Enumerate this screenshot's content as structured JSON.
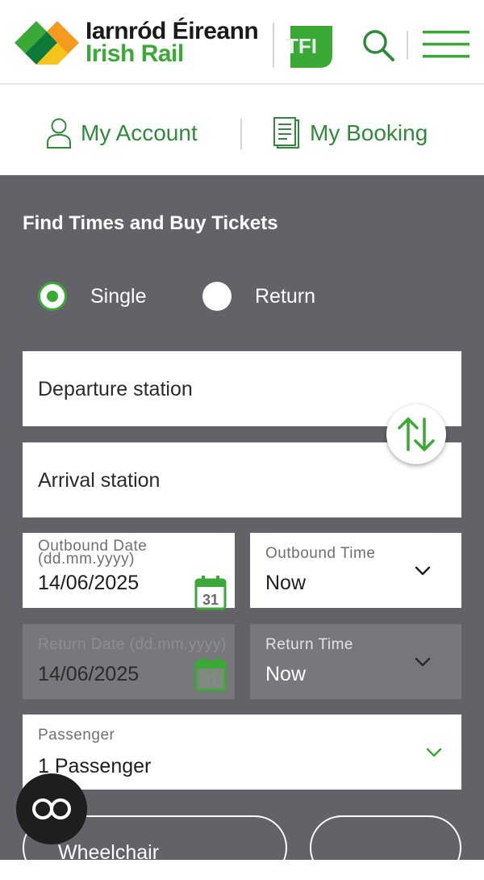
{
  "header": {
    "brand_line1": "Iarnród Éireann",
    "brand_line2": "Irish Rail",
    "tfi_logo": "TFI",
    "search_icon": "search-icon",
    "menu_icon": "hamburger-menu-icon"
  },
  "account_bar": {
    "my_account": "My Account",
    "my_booking": "My Booking"
  },
  "form": {
    "title": "Find Times and Buy Tickets",
    "journey_type": {
      "options": [
        "Single",
        "Return"
      ],
      "selected": "Single"
    },
    "departure_placeholder": "Departure station",
    "arrival_placeholder": "Arrival station",
    "outbound_date_label_1": "Outbound Date",
    "outbound_date_label_2": "(dd.mm.yyyy)",
    "outbound_date_value": "14/06/2025",
    "outbound_time_label": "Outbound Time",
    "outbound_time_value": "Now",
    "return_date_label": "Return Date (dd.mm.yyyy)",
    "return_date_value": "14/06/2025",
    "return_time_label": "Return Time",
    "return_time_value": "Now",
    "passenger_label": "Passenger",
    "passenger_value": "1 Passenger",
    "calendar_day": "31",
    "wheelchair_label": "Wheelchair"
  },
  "colors": {
    "brand_green": "#3aa935",
    "panel_bg": "#636268",
    "text_green": "#2f8a3a"
  }
}
